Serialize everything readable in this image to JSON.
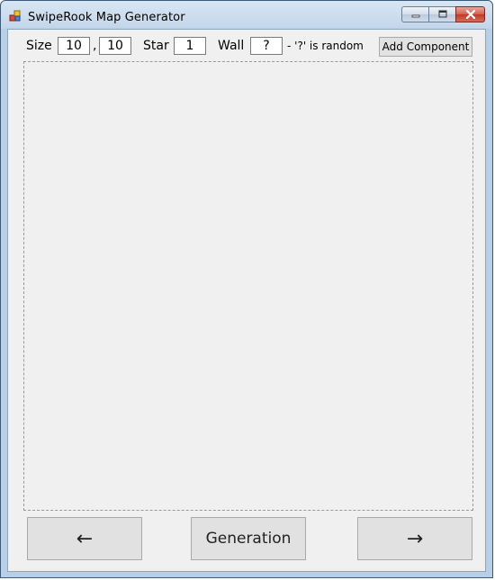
{
  "window": {
    "title": "SwipeRook Map Generator"
  },
  "controls": {
    "size_label": "Size",
    "size_width": "10",
    "size_sep": ",",
    "size_height": "10",
    "star_label": "Star",
    "star_value": "1",
    "wall_label": "Wall",
    "wall_value": "?",
    "random_hint": "- '?' is random",
    "add_component_label": "Add Component"
  },
  "buttons": {
    "prev_label": "←",
    "generation_label": "Generation",
    "next_label": "→"
  },
  "icons": {
    "app": "app-icon",
    "minimize": "minimize-icon",
    "maximize": "maximize-icon",
    "close": "close-icon"
  },
  "colors": {
    "titlebar": "#c3d6ea",
    "client_bg": "#f0f0f0",
    "close_button": "#c0392b"
  }
}
